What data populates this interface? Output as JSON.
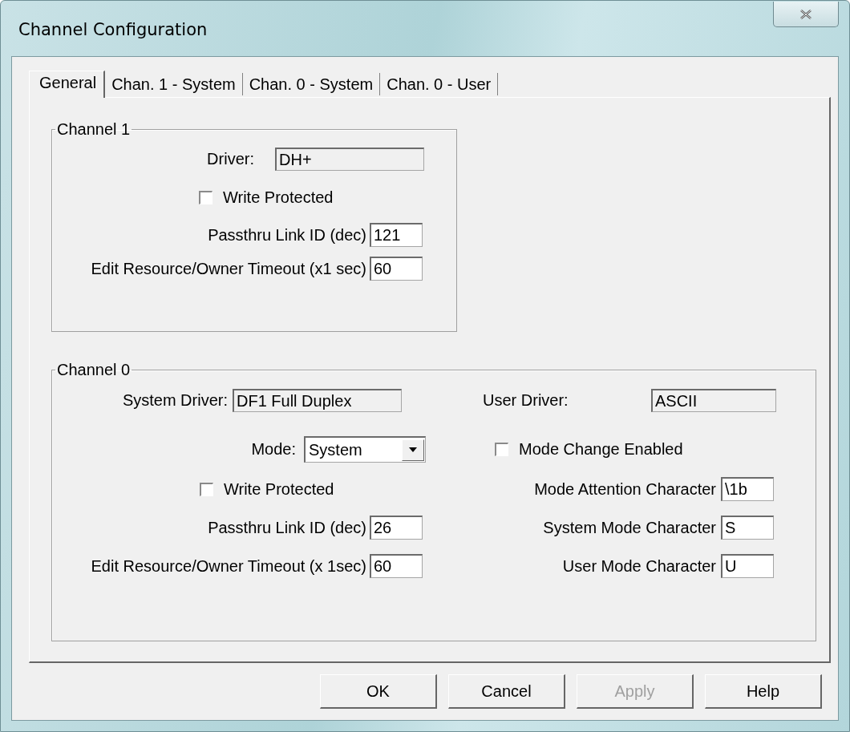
{
  "window": {
    "title": "Channel Configuration"
  },
  "tabs": [
    {
      "label": "General",
      "selected": true
    },
    {
      "label": "Chan. 1 - System",
      "selected": false
    },
    {
      "label": "Chan. 0 - System",
      "selected": false
    },
    {
      "label": "Chan. 0 - User",
      "selected": false
    }
  ],
  "channel_1": {
    "title": "Channel 1",
    "driver": {
      "label": "Driver:",
      "value": "DH+"
    },
    "write_protected": {
      "label": "Write Protected",
      "checked": false
    },
    "passthru_link_id": {
      "label": "Passthru Link ID (dec)",
      "value": "121"
    },
    "edit_timeout": {
      "label": "Edit Resource/Owner Timeout (x1 sec)",
      "value": "60"
    }
  },
  "channel_0": {
    "title": "Channel 0",
    "system_driver": {
      "label": "System Driver:",
      "value": "DF1 Full Duplex"
    },
    "user_driver": {
      "label": "User Driver:",
      "value": "ASCII"
    },
    "mode": {
      "label": "Mode:",
      "value": "System"
    },
    "mode_change_enabled": {
      "label": "Mode Change Enabled",
      "checked": false
    },
    "write_protected": {
      "label": "Write Protected",
      "checked": false
    },
    "mode_attention_character": {
      "label": "Mode Attention Character",
      "value": "\\1b"
    },
    "passthru_link_id": {
      "label": "Passthru Link ID (dec)",
      "value": "26"
    },
    "system_mode_character": {
      "label": "System Mode Character",
      "value": "S"
    },
    "edit_timeout": {
      "label": "Edit Resource/Owner Timeout (x 1sec)",
      "value": "60"
    },
    "user_mode_character": {
      "label": "User Mode Character",
      "value": "U"
    }
  },
  "buttons": [
    {
      "label": "OK",
      "disabled": false
    },
    {
      "label": "Cancel",
      "disabled": false
    },
    {
      "label": "Apply",
      "disabled": true
    },
    {
      "label": "Help",
      "disabled": false
    }
  ]
}
